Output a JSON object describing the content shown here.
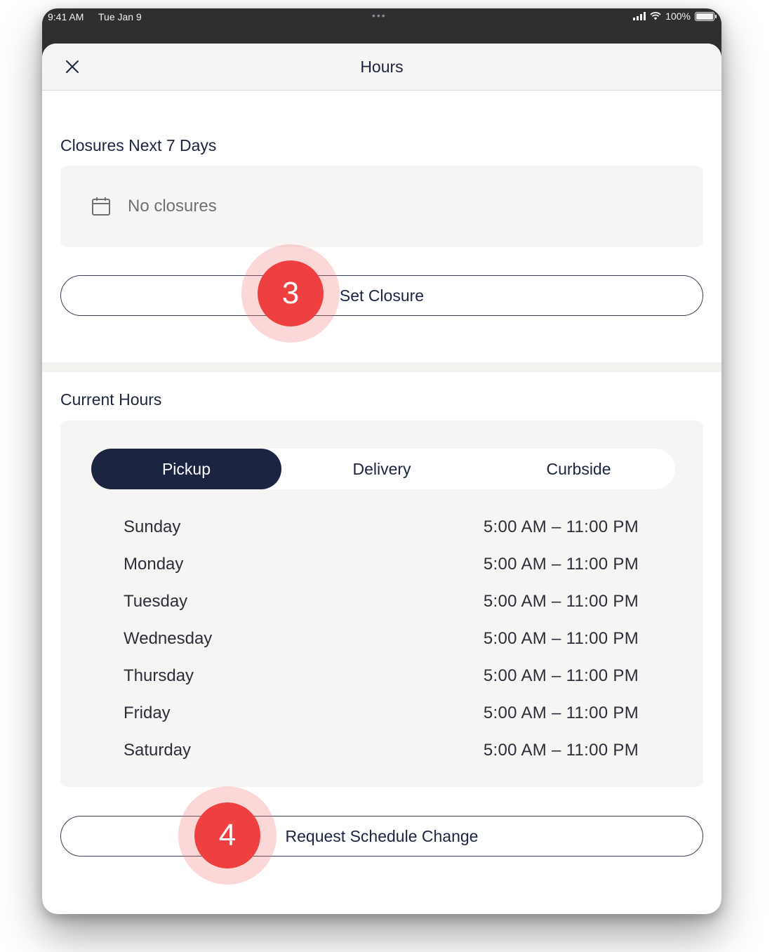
{
  "status_bar": {
    "time": "9:41 AM",
    "date": "Tue Jan 9",
    "battery": "100%"
  },
  "header": {
    "title": "Hours",
    "close_icon": "close-icon"
  },
  "closures": {
    "label": "Closures Next 7 Days",
    "empty_text": "No closures",
    "icon": "calendar-icon",
    "button_label": "Set Closure"
  },
  "current_hours": {
    "label": "Current Hours",
    "tabs": [
      {
        "label": "Pickup",
        "active": true
      },
      {
        "label": "Delivery",
        "active": false
      },
      {
        "label": "Curbside",
        "active": false
      }
    ],
    "rows": [
      {
        "day": "Sunday",
        "hours": "5:00 AM  –  11:00 PM"
      },
      {
        "day": "Monday",
        "hours": "5:00 AM  –  11:00 PM"
      },
      {
        "day": "Tuesday",
        "hours": "5:00 AM  –  11:00 PM"
      },
      {
        "day": "Wednesday",
        "hours": "5:00 AM  –  11:00 PM"
      },
      {
        "day": "Thursday",
        "hours": "5:00 AM  –  11:00 PM"
      },
      {
        "day": "Friday",
        "hours": "5:00 AM  –  11:00 PM"
      },
      {
        "day": "Saturday",
        "hours": "5:00 AM  –  11:00 PM"
      }
    ],
    "button_label": "Request Schedule Change"
  },
  "callouts": [
    "3",
    "4"
  ],
  "colors": {
    "navy": "#1b2440",
    "panel": "#f6f5f3",
    "callout": "#ee4040"
  }
}
